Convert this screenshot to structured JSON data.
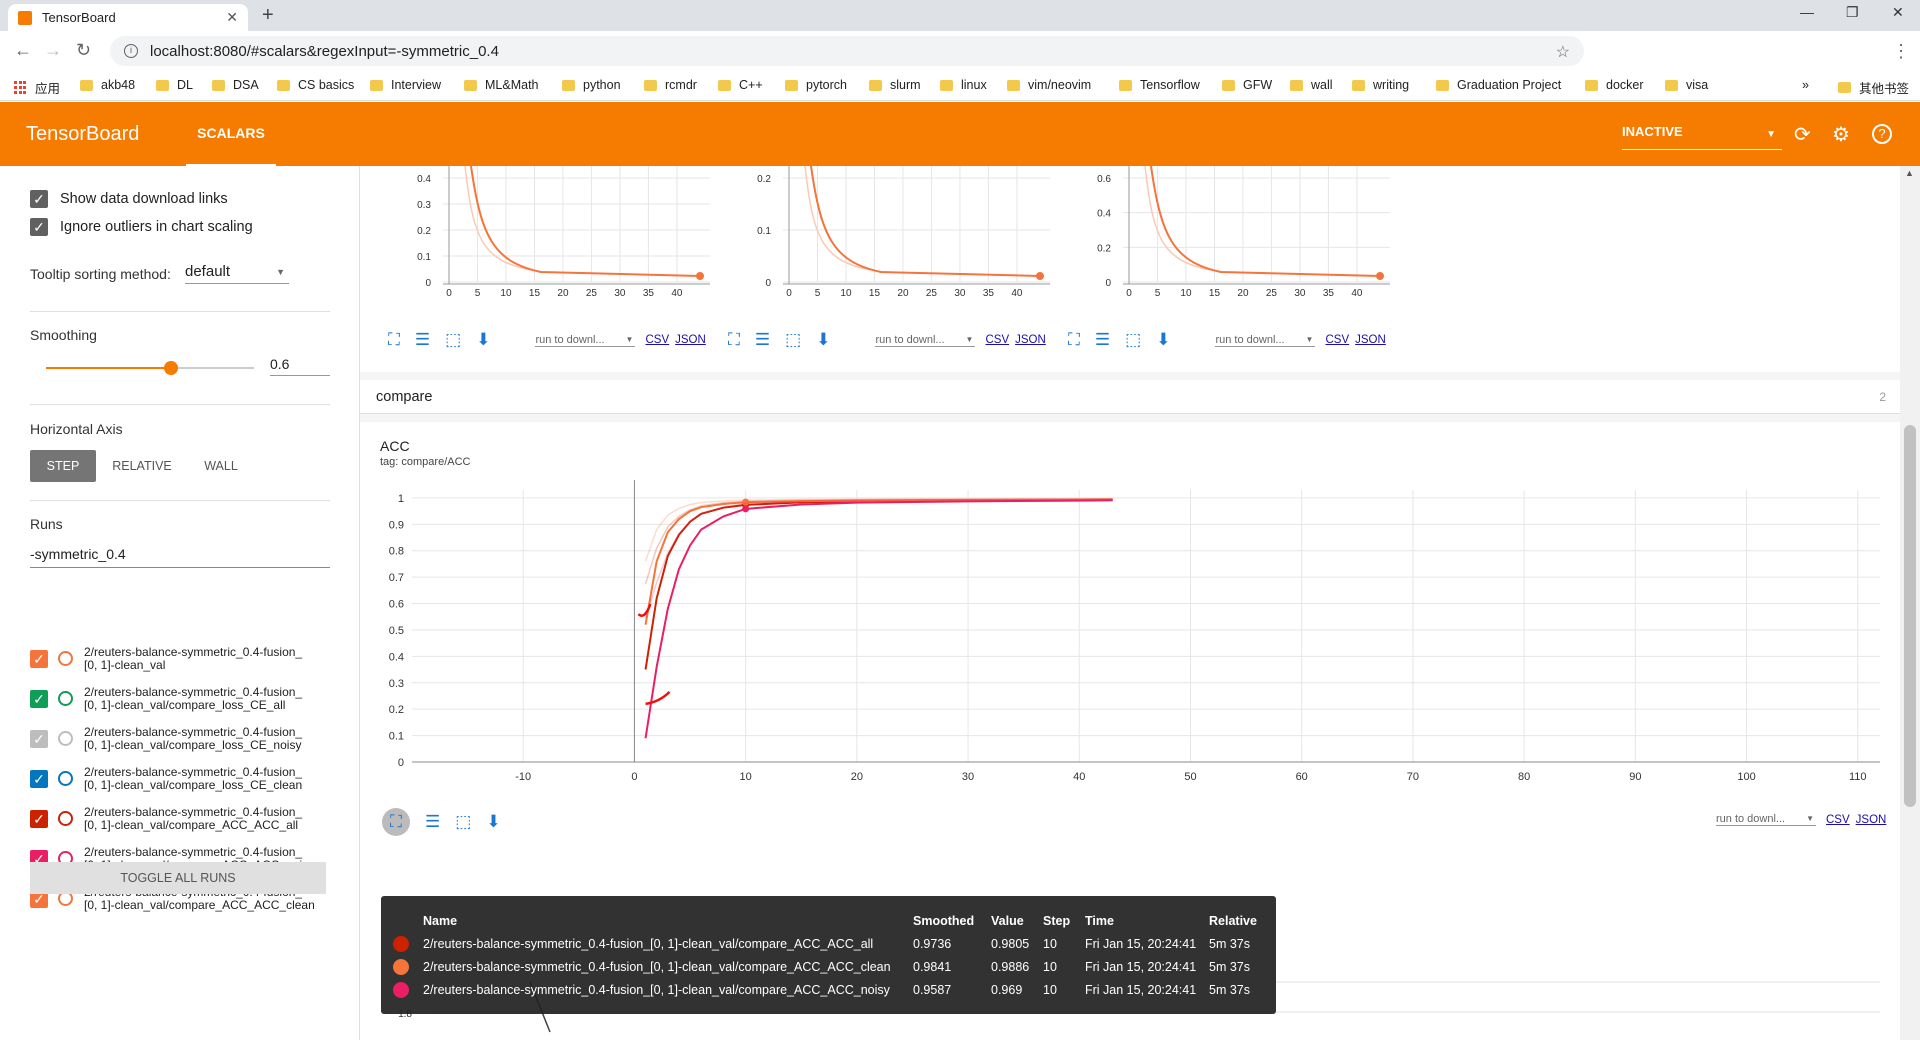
{
  "browser": {
    "tab_title": "TensorBoard",
    "tab_close": "✕",
    "newtab_symbol": "+",
    "url": "localhost:8080/#scalars&regexInput=-symmetric_0.4",
    "bookmarks": [
      "应用",
      "akb48",
      "DL",
      "DSA",
      "CS basics",
      "Interview",
      "ML&Math",
      "python",
      "rcmdr",
      "C++",
      "pytorch",
      "slurm",
      "linux",
      "vim/neovim",
      "Tensorflow",
      "GFW",
      "wall",
      "writing",
      "Graduation Project",
      "docker",
      "visa"
    ],
    "bookmarks_more": "»",
    "other_bookmarks": "其他书签"
  },
  "header": {
    "title": "TensorBoard",
    "tab_scalars": "SCALARS",
    "run_select": "INACTIVE"
  },
  "sidebar": {
    "show_download_links": "Show data download links",
    "ignore_outliers": "Ignore outliers in chart scaling",
    "tooltip_sorting_label": "Tooltip sorting method:",
    "tooltip_sorting_value": "default",
    "smoothing_label": "Smoothing",
    "smoothing_value": "0.6",
    "smoothing_fraction": 0.6,
    "horizontal_axis_label": "Horizontal Axis",
    "axis_step": "STEP",
    "axis_relative": "RELATIVE",
    "axis_wall": "WALL",
    "runs_label": "Runs",
    "runs_filter": "-symmetric_0.4",
    "runs": [
      {
        "line1": "2/reuters-balance-symmetric_0.4-fusion_",
        "line2": "[0, 1]-clean_val",
        "color": "#f4743b",
        "checked": true
      },
      {
        "line1": "2/reuters-balance-symmetric_0.4-fusion_",
        "line2": "[0, 1]-clean_val/compare_loss_CE_all",
        "color": "#0f9d58",
        "checked": true
      },
      {
        "line1": "2/reuters-balance-symmetric_0.4-fusion_",
        "line2": "[0, 1]-clean_val/compare_loss_CE_noisy",
        "color": "#bdbdbd",
        "checked": true
      },
      {
        "line1": "2/reuters-balance-symmetric_0.4-fusion_",
        "line2": "[0, 1]-clean_val/compare_loss_CE_clean",
        "color": "#0277bd",
        "checked": true
      },
      {
        "line1": "2/reuters-balance-symmetric_0.4-fusion_",
        "line2": "[0, 1]-clean_val/compare_ACC_ACC_all",
        "color": "#cc2200",
        "checked": true
      },
      {
        "line1": "2/reuters-balance-symmetric_0.4-fusion_",
        "line2": "[0, 1]-clean_val/compare_ACC_ACC_noisy",
        "color": "#e91e63",
        "checked": true
      },
      {
        "line1": "2/reuters-balance-symmetric_0.4-fusion_",
        "line2": "[0, 1]-clean_val/compare_ACC_ACC_clean",
        "color": "#f4743b",
        "checked": true
      }
    ],
    "toggle_all": "TOGGLE ALL RUNS"
  },
  "top_charts": {
    "run_to_download": "run to downl...",
    "csv": "CSV",
    "json": "JSON",
    "x_ticks": [
      "0",
      "5",
      "10",
      "15",
      "20",
      "25",
      "30",
      "35",
      "40"
    ],
    "y_ticks": [
      [
        "0.4",
        "0.3",
        "0.2",
        "0.1",
        "0"
      ],
      [
        "0.2",
        "0.1",
        "0"
      ],
      [
        "0.6",
        "0.4",
        "0.2",
        "0"
      ]
    ]
  },
  "compare_group": {
    "name": "compare",
    "count": "2"
  },
  "acc_chart": {
    "title": "ACC",
    "tag": "tag: compare/ACC",
    "run_to_download": "run to downl...",
    "csv": "CSV",
    "json": "JSON"
  },
  "chart_data": {
    "type": "line",
    "title": "ACC",
    "xlabel": "",
    "ylabel": "",
    "xlim": [
      -20,
      112
    ],
    "ylim": [
      0,
      1.03
    ],
    "x_ticks": [
      -10,
      0,
      10,
      20,
      30,
      40,
      50,
      60,
      70,
      80,
      90,
      100,
      110
    ],
    "y_ticks": [
      0,
      0.1,
      0.2,
      0.3,
      0.4,
      0.5,
      0.6,
      0.7,
      0.8,
      0.9,
      1
    ],
    "grid": true,
    "series": [
      {
        "name": "2/reuters-balance-symmetric_0.4-fusion_[0, 1]-clean_val/compare_ACC_ACC_all",
        "color": "#cc2200",
        "x": [
          1,
          2,
          3,
          4,
          5,
          6,
          8,
          10,
          15,
          20,
          30,
          40,
          43
        ],
        "y": [
          0.35,
          0.62,
          0.78,
          0.86,
          0.91,
          0.94,
          0.963,
          0.9736,
          0.983,
          0.987,
          0.99,
          0.992,
          0.993
        ]
      },
      {
        "name": "2/reuters-balance-symmetric_0.4-fusion_[0, 1]-clean_val/compare_ACC_ACC_clean",
        "color": "#f4743b",
        "x": [
          1,
          2,
          3,
          4,
          5,
          6,
          8,
          10,
          15,
          20,
          30,
          40,
          43
        ],
        "y": [
          0.52,
          0.76,
          0.87,
          0.92,
          0.95,
          0.965,
          0.977,
          0.9841,
          0.988,
          0.99,
          0.992,
          0.993,
          0.994
        ]
      },
      {
        "name": "2/reuters-balance-symmetric_0.4-fusion_[0, 1]-clean_val/compare_ACC_ACC_noisy",
        "color": "#e91e63",
        "x": [
          1,
          2,
          3,
          4,
          5,
          6,
          8,
          10,
          15,
          20,
          30,
          40,
          43
        ],
        "y": [
          0.09,
          0.36,
          0.58,
          0.73,
          0.82,
          0.88,
          0.93,
          0.9587,
          0.975,
          0.982,
          0.987,
          0.99,
          0.991
        ]
      }
    ]
  },
  "loss_chart": {
    "y_tick": "1.8"
  },
  "tooltip": {
    "headers": [
      "Name",
      "Smoothed",
      "Value",
      "Step",
      "Time",
      "Relative"
    ],
    "rows": [
      {
        "color": "#cc2200",
        "name": "2/reuters-balance-symmetric_0.4-fusion_[0, 1]-clean_val/compare_ACC_ACC_all",
        "smoothed": "0.9736",
        "value": "0.9805",
        "step": "10",
        "time": "Fri Jan 15, 20:24:41",
        "relative": "5m 37s"
      },
      {
        "color": "#f4743b",
        "name": "2/reuters-balance-symmetric_0.4-fusion_[0, 1]-clean_val/compare_ACC_ACC_clean",
        "smoothed": "0.9841",
        "value": "0.9886",
        "step": "10",
        "time": "Fri Jan 15, 20:24:41",
        "relative": "5m 37s"
      },
      {
        "color": "#e91e63",
        "name": "2/reuters-balance-symmetric_0.4-fusion_[0, 1]-clean_val/compare_ACC_ACC_noisy",
        "smoothed": "0.9587",
        "value": "0.969",
        "step": "10",
        "time": "Fri Jan 15, 20:24:41",
        "relative": "5m 37s"
      }
    ]
  },
  "colors": {
    "accent": "#f57c00",
    "link": "#1a0dab",
    "icon_blue": "#1976d2"
  }
}
